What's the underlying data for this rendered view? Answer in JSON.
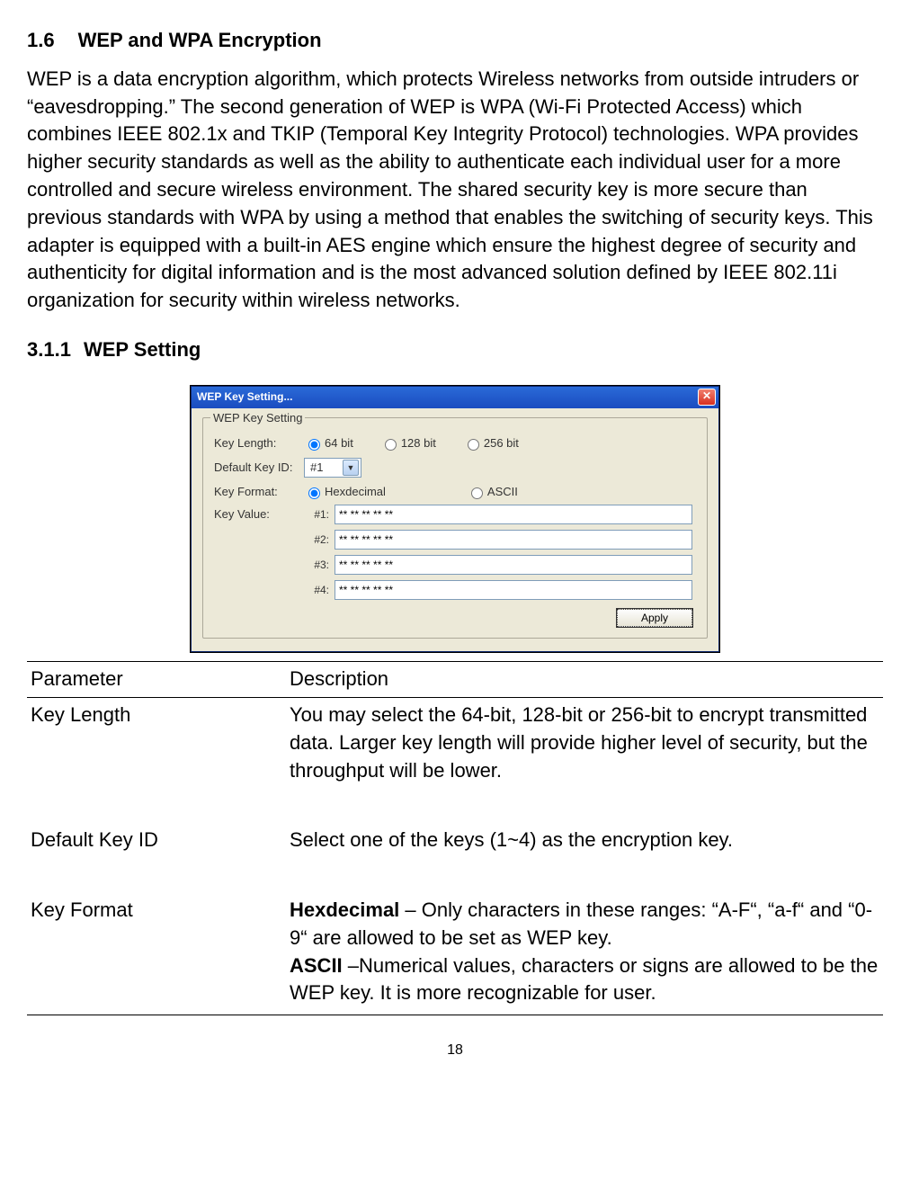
{
  "heading1": {
    "num": "1.6",
    "title": "WEP and WPA Encryption"
  },
  "body": "WEP is a data encryption algorithm, which protects Wireless networks from outside intruders or “eavesdropping.”    The second generation of WEP is WPA (Wi-Fi Protected Access) which combines IEEE 802.1x and TKIP (Temporal Key Integrity Protocol) technologies. WPA provides higher security standards as well as the ability to authenticate each individual user for a more controlled and secure wireless environment.    The shared security key is more secure than previous standards with WPA by using a method that enables the switching of security keys.    This adapter is equipped with a built-in AES engine which ensure the highest degree of security and authenticity for digital information and is the most advanced solution defined by IEEE 802.11i organization for security within wireless networks.",
  "heading2": {
    "num": "3.1.1",
    "title": "WEP Setting"
  },
  "dialog": {
    "title": "WEP Key Setting...",
    "group": "WEP Key Setting",
    "labels": {
      "keyLength": "Key Length:",
      "defaultKeyId": "Default Key ID:",
      "keyFormat": "Key Format:",
      "keyValue": "Key Value:"
    },
    "radios": {
      "b64": "64 bit",
      "b128": "128 bit",
      "b256": "256 bit",
      "hex": "Hexdecimal",
      "ascii": "ASCII"
    },
    "select": "#1",
    "keys": [
      {
        "idx": "#1:",
        "val": "** ** ** ** **"
      },
      {
        "idx": "#2:",
        "val": "** ** ** ** **"
      },
      {
        "idx": "#3:",
        "val": "** ** ** ** **"
      },
      {
        "idx": "#4:",
        "val": "** ** ** ** **"
      }
    ],
    "apply": "Apply"
  },
  "table": {
    "head": {
      "c1": "Parameter",
      "c2": "Description"
    },
    "rows": {
      "keyLength": {
        "c1": "Key Length",
        "c2": "You may select the 64-bit, 128-bit or 256-bit to encrypt transmitted data. Larger key length will provide higher level of security, but the throughput will be lower."
      },
      "defaultKeyId": {
        "c1": "Default Key ID",
        "c2": "Select one of the keys (1~4) as the encryption key."
      },
      "keyFormat": {
        "c1": "Key Format",
        "hexB": "Hexdecimal",
        "hex": " – Only characters in these ranges: “A-F“, “a-f“ and “0-9“ are allowed to be set as WEP key.",
        "asciiB": "ASCII",
        "ascii": " –Numerical values, characters or signs are allowed to be the WEP key. It is more recognizable for user."
      }
    }
  },
  "pageNum": "18"
}
